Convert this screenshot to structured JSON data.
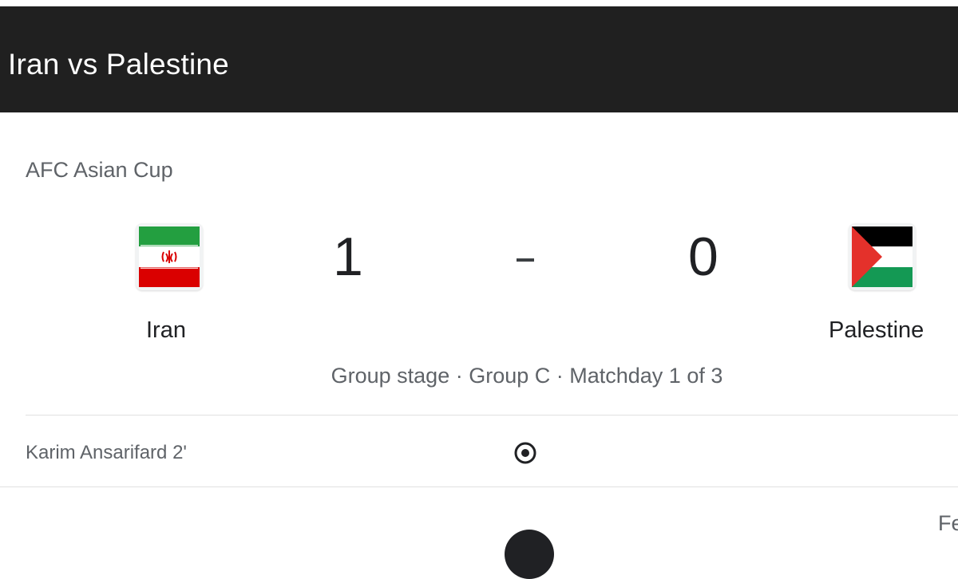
{
  "header": {
    "title": "Iran vs Palestine"
  },
  "match": {
    "competition": "AFC Asian Cup",
    "home_team": {
      "name": "Iran",
      "flag_icon": "iran-flag-icon",
      "score": "1"
    },
    "away_team": {
      "name": "Palestine",
      "flag_icon": "palestine-flag-icon",
      "score": "0"
    },
    "separator": "-",
    "stage_info": "Group stage · Group C · Matchday 1 of 3"
  },
  "events": [
    {
      "player": "Karim Ansarifard 2'",
      "icon": "goal-icon"
    }
  ],
  "bottom": {
    "partial_text": "Fe"
  },
  "colors": {
    "header_bg": "#202020",
    "text_primary": "#202124",
    "text_secondary": "#5f6368",
    "divider": "#e0e0e0"
  }
}
